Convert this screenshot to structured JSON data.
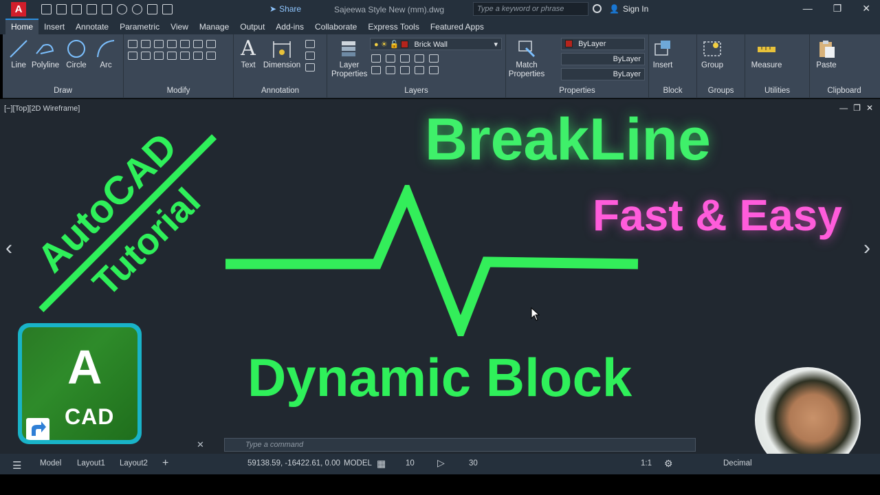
{
  "titlebar": {
    "app_letter": "A",
    "share_label": "Share",
    "document_title": "Sajeewa Style New (mm).dwg",
    "search_placeholder": "Type a keyword or phrase",
    "signin_label": "Sign In"
  },
  "ribbon_tabs": [
    "Home",
    "Insert",
    "Annotate",
    "Parametric",
    "View",
    "Manage",
    "Output",
    "Add-ins",
    "Collaborate",
    "Express Tools",
    "Featured Apps"
  ],
  "ribbon": {
    "draw": {
      "title": "Draw",
      "tools": [
        "Line",
        "Polyline",
        "Circle",
        "Arc"
      ]
    },
    "modify": {
      "title": "Modify"
    },
    "annotation": {
      "title": "Annotation",
      "tools": [
        "Text",
        "Dimension"
      ]
    },
    "layers": {
      "title": "Layers",
      "tool": "Layer Properties",
      "layer_value": "Brick Wall"
    },
    "properties": {
      "title": "Properties",
      "tool": "Match Properties",
      "color_value": "ByLayer",
      "linetype_value": "ByLayer",
      "lineweight_value": "ByLayer"
    },
    "block": {
      "title": "Block",
      "tool": "Insert"
    },
    "groups": {
      "title": "Groups",
      "tool": "Group"
    },
    "utilities": {
      "title": "Utilities",
      "tool": "Measure"
    },
    "clipboard": {
      "title": "Clipboard",
      "tool": "Paste"
    }
  },
  "viewport": {
    "label": "[−][Top][2D Wireframe]"
  },
  "overlay": {
    "headline": "BreakLine",
    "sub_headline": "Fast & Easy",
    "block_title": "Dynamic Block",
    "stamp_line1": "AutoCAD",
    "stamp_line2": "Tutorial",
    "logo_letter": "A",
    "logo_word": "CAD"
  },
  "command": {
    "placeholder": "Type a command"
  },
  "statusbar": {
    "model_tab": "Model",
    "layout_tabs": [
      "Layout1",
      "Layout2"
    ],
    "coordinates": "59138.59, -16422.61, 0.00",
    "mode": "MODEL",
    "rewind": "10",
    "forward": "30",
    "scale": "1:1",
    "units": "Decimal"
  },
  "colors": {
    "headline": "#3ff06a",
    "sub_headline": "#ff5cdb",
    "breakline": "#33ee5a",
    "canvas": "#212830"
  }
}
